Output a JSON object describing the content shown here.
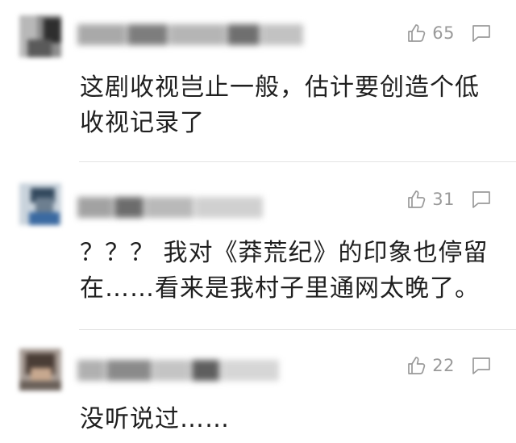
{
  "comments": [
    {
      "like_count": "65",
      "text": "这剧收视岂止一般，估计要创造个低收视记录了",
      "icons": [
        "thumbs-up-icon",
        "comment-bubble-icon"
      ]
    },
    {
      "like_count": "31",
      "text": "？？？ 我对《莽荒纪》的印象也停留在……看来是我村子里通网太晚了。",
      "icons": [
        "thumbs-up-icon",
        "comment-bubble-icon"
      ]
    },
    {
      "like_count": "22",
      "text": "没听说过……",
      "icons": [
        "thumbs-up-icon",
        "comment-bubble-icon"
      ]
    }
  ],
  "colors": {
    "text": "#1f1f1f",
    "meta": "#9a9a9a",
    "divider": "#e3e3e3",
    "background": "#ffffff"
  }
}
